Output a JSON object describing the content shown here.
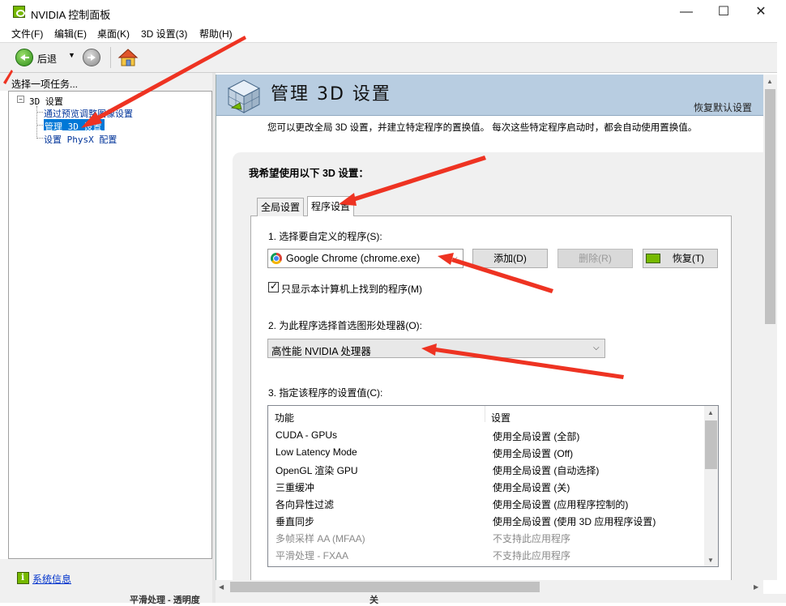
{
  "window": {
    "title": "NVIDIA 控制面板",
    "minimize": "—",
    "maximize": "☐",
    "close": "✕"
  },
  "menu": [
    "文件(F)",
    "编辑(E)",
    "桌面(K)",
    "3D 设置(3)",
    "帮助(H)"
  ],
  "toolbar": {
    "back_label": "后退",
    "back_dropdown": "▼"
  },
  "left_panel": {
    "header": "选择一项任务...",
    "tree": {
      "root": "3D 设置",
      "items": [
        "通过预览调整图像设置",
        "管理 3D 设置",
        "设置 PhysX 配置"
      ],
      "selected_index": 1
    },
    "footer_link": "系统信息"
  },
  "main": {
    "title": "管理 3D 设置",
    "restore_defaults": "恢复默认设置",
    "description": "您可以更改全局 3D 设置，并建立特定程序的置换值。 每次这些特定程序启动时，都会自动使用置换值。",
    "section_heading": "我希望使用以下 3D 设置：",
    "tabs": [
      "全局设置",
      "程序设置"
    ],
    "active_tab": 1,
    "step1_label": "1. 选择要自定义的程序(S):",
    "program_value": "Google Chrome (chrome.exe)",
    "add_button": "添加(D)",
    "remove_button": "删除(R)",
    "restore_button": "恢复(T)",
    "checkbox_label": "只显示本计算机上找到的程序(M)",
    "checkbox_checked": true,
    "step2_label": "2. 为此程序选择首选图形处理器(O):",
    "gpu_value": "高性能 NVIDIA 处理器",
    "step3_label": "3. 指定该程序的设置值(C):",
    "settings_table": {
      "columns": [
        "功能",
        "设置"
      ],
      "rows": [
        {
          "feature": "CUDA - GPUs",
          "setting": "使用全局设置 (全部)",
          "enabled": true
        },
        {
          "feature": "Low Latency Mode",
          "setting": "使用全局设置 (Off)",
          "enabled": true
        },
        {
          "feature": "OpenGL 渲染 GPU",
          "setting": "使用全局设置 (自动选择)",
          "enabled": true
        },
        {
          "feature": "三重缓冲",
          "setting": "使用全局设置 (关)",
          "enabled": true
        },
        {
          "feature": "各向异性过滤",
          "setting": "使用全局设置 (应用程序控制的)",
          "enabled": true
        },
        {
          "feature": "垂直同步",
          "setting": "使用全局设置 (使用 3D 应用程序设置)",
          "enabled": true
        },
        {
          "feature": "多帧采样 AA (MFAA)",
          "setting": "不支持此应用程序",
          "enabled": false
        },
        {
          "feature": "平滑处理 - FXAA",
          "setting": "不支持此应用程序",
          "enabled": false
        }
      ]
    }
  },
  "background_peek": [
    "平滑处理 - 透明度",
    "关"
  ],
  "colors": {
    "nvidia_green": "#76b900",
    "banner": "#b8cde1",
    "selection": "#0078d7",
    "annotation_arrow": "#ee3322"
  },
  "icons": {
    "app": "nvidia-logo-icon",
    "back": "back-arrow-icon",
    "forward": "forward-arrow-icon",
    "home": "home-icon",
    "banner": "3d-cube-icon",
    "program": "chrome-icon",
    "restore": "nvidia-logo-icon",
    "sysinfo": "info-icon"
  }
}
